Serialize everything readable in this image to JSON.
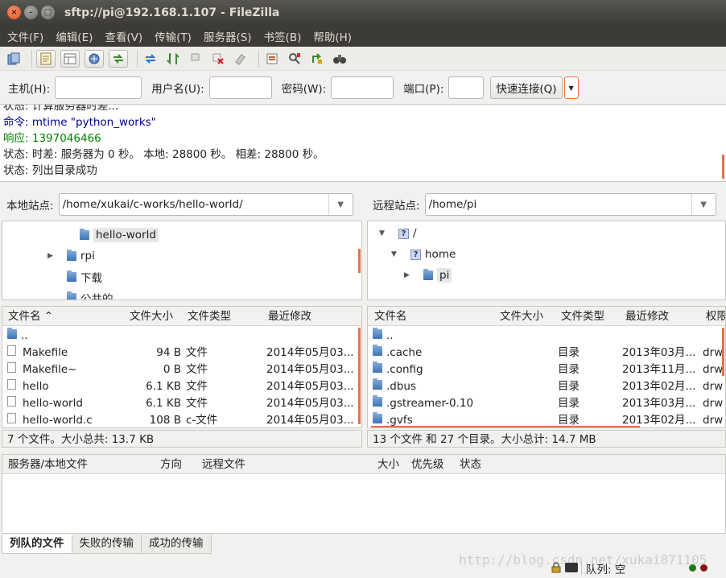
{
  "window": {
    "title": "sftp://pi@192.168.1.107 - FileZilla",
    "close": "×",
    "minimize": "–",
    "maximize": "□"
  },
  "menu": [
    "文件(F)",
    "编辑(E)",
    "查看(V)",
    "传输(T)",
    "服务器(S)",
    "书签(B)",
    "帮助(H)"
  ],
  "toolbar_icons": [
    "site-manager-icon",
    "message-log-icon",
    "directory-tree-icon",
    "remote-tree-icon",
    "transfer-queue-icon",
    "refresh-icon",
    "process-queue-icon",
    "stop-icon",
    "disconnect-icon",
    "reconnect-icon",
    "directory-listing-filter-icon",
    "directory-comparison-icon",
    "sync-browsing-icon",
    "search-icon"
  ],
  "quickconnect": {
    "host_label": "主机(H):",
    "host_value": "",
    "user_label": "用户名(U):",
    "user_value": "",
    "pass_label": "密码(W):",
    "pass_value": "",
    "port_label": "端口(P):",
    "port_value": "",
    "button": "快速连接(Q)",
    "dropdown": "▼"
  },
  "log": [
    {
      "prefix": "状态:",
      "text": "计算服务器时差...",
      "color": "#222222"
    },
    {
      "prefix": "命令:",
      "text": "mtime \"python_works\"",
      "color": "#00008b"
    },
    {
      "prefix": "响应:",
      "text": "1397046466",
      "color": "#008000"
    },
    {
      "prefix": "状态:",
      "text": "时差: 服务器为 0 秒。 本地: 28800 秒。 相差: 28800 秒。",
      "color": "#222222"
    },
    {
      "prefix": "状态:",
      "text": "列出目录成功",
      "color": "#222222"
    }
  ],
  "local": {
    "site_label": "本地站点:",
    "path": "/home/xukai/c-works/hello-world/",
    "tree": [
      {
        "expander": "",
        "name": "hello-world",
        "selected": true
      },
      {
        "expander": "▶",
        "name": "rpi",
        "selected": false
      },
      {
        "expander": "",
        "name": "下载",
        "selected": false
      },
      {
        "expander": "",
        "name": "公共的",
        "selected": false
      }
    ],
    "columns": {
      "name": "文件名",
      "sort": "⌃",
      "size": "文件大小",
      "type": "文件类型",
      "modified": "最近修改"
    },
    "files": [
      {
        "name": "..",
        "size": "",
        "type": "",
        "modified": "",
        "kind": "folder"
      },
      {
        "name": "Makefile",
        "size": "94 B",
        "type": "文件",
        "modified": "2014年05月03...",
        "kind": "file"
      },
      {
        "name": "Makefile~",
        "size": "0 B",
        "type": "文件",
        "modified": "2014年05月03...",
        "kind": "file"
      },
      {
        "name": "hello",
        "size": "6.1 KB",
        "type": "文件",
        "modified": "2014年05月03...",
        "kind": "file"
      },
      {
        "name": "hello-world",
        "size": "6.1 KB",
        "type": "文件",
        "modified": "2014年05月03...",
        "kind": "file"
      },
      {
        "name": "hello-world.c",
        "size": "108 B",
        "type": "c-文件",
        "modified": "2014年05月03...",
        "kind": "file"
      }
    ],
    "status": "7 个文件。大小总共: 13.7 KB"
  },
  "remote": {
    "site_label": "远程站点:",
    "path": "/home/pi",
    "tree": [
      {
        "expander": "▼",
        "name": "/",
        "icon": "question"
      },
      {
        "expander": "▼",
        "name": "home",
        "icon": "question"
      },
      {
        "expander": "▶",
        "name": "pi",
        "icon": "folder",
        "selected": true
      }
    ],
    "columns": {
      "name": "文件名",
      "size": "文件大小",
      "type": "文件类型",
      "modified": "最近修改",
      "perm": "权限"
    },
    "files": [
      {
        "name": "..",
        "size": "",
        "type": "",
        "modified": "",
        "perm": ""
      },
      {
        "name": ".cache",
        "size": "",
        "type": "目录",
        "modified": "2013年03月...",
        "perm": "drw"
      },
      {
        "name": ".config",
        "size": "",
        "type": "目录",
        "modified": "2013年11月...",
        "perm": "drw"
      },
      {
        "name": ".dbus",
        "size": "",
        "type": "目录",
        "modified": "2013年02月...",
        "perm": "drw"
      },
      {
        "name": ".gstreamer-0.10",
        "size": "",
        "type": "目录",
        "modified": "2013年03月...",
        "perm": "drw"
      },
      {
        "name": ".gvfs",
        "size": "",
        "type": "目录",
        "modified": "2013年02月...",
        "perm": "drw"
      }
    ],
    "status": "13 个文件 和 27 个目录。大小总计: 14.7 MB"
  },
  "queue": {
    "columns": {
      "server": "服务器/本地文件",
      "direction": "方向",
      "remote": "远程文件",
      "size": "大小",
      "priority": "优先级",
      "status": "状态"
    },
    "tabs": [
      "列队的文件",
      "失败的传输",
      "成功的传输"
    ]
  },
  "bottom": {
    "queue_label": "队列: 空"
  },
  "watermark": "http://blog.csdn.net/xukai871105",
  "colors": {
    "accent": "#e67343",
    "titlebar": "#3c3b37",
    "selection": "#e6e6e6"
  }
}
